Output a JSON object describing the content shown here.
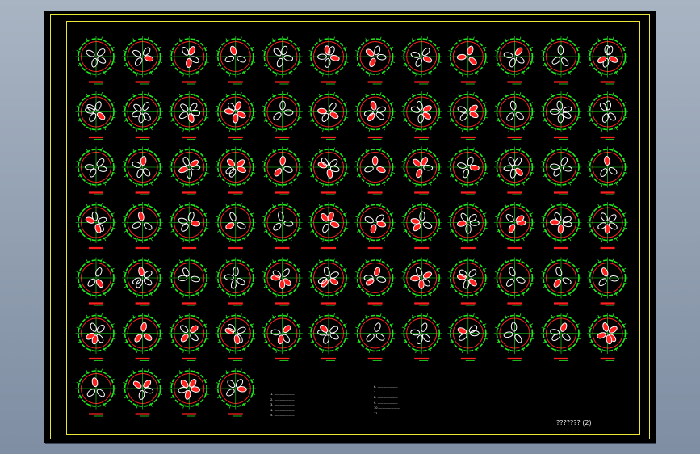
{
  "drawing": {
    "sheet_title": "???????  (2)",
    "notes_heading": "",
    "notes_left": [
      "1. ",
      "2. ",
      "3. ",
      "4. ",
      "5. "
    ],
    "notes_right": [
      "6. ",
      "7. ",
      "8. ",
      "9. ",
      "10. ",
      "11. "
    ],
    "colors": {
      "background": "#000000",
      "frame": "#e8e835",
      "dimension": "#21e821",
      "section": "#ff2020",
      "hole": "#ffffff"
    },
    "grid": {
      "rows": 7,
      "columns": 12,
      "last_row_items": 4
    }
  }
}
